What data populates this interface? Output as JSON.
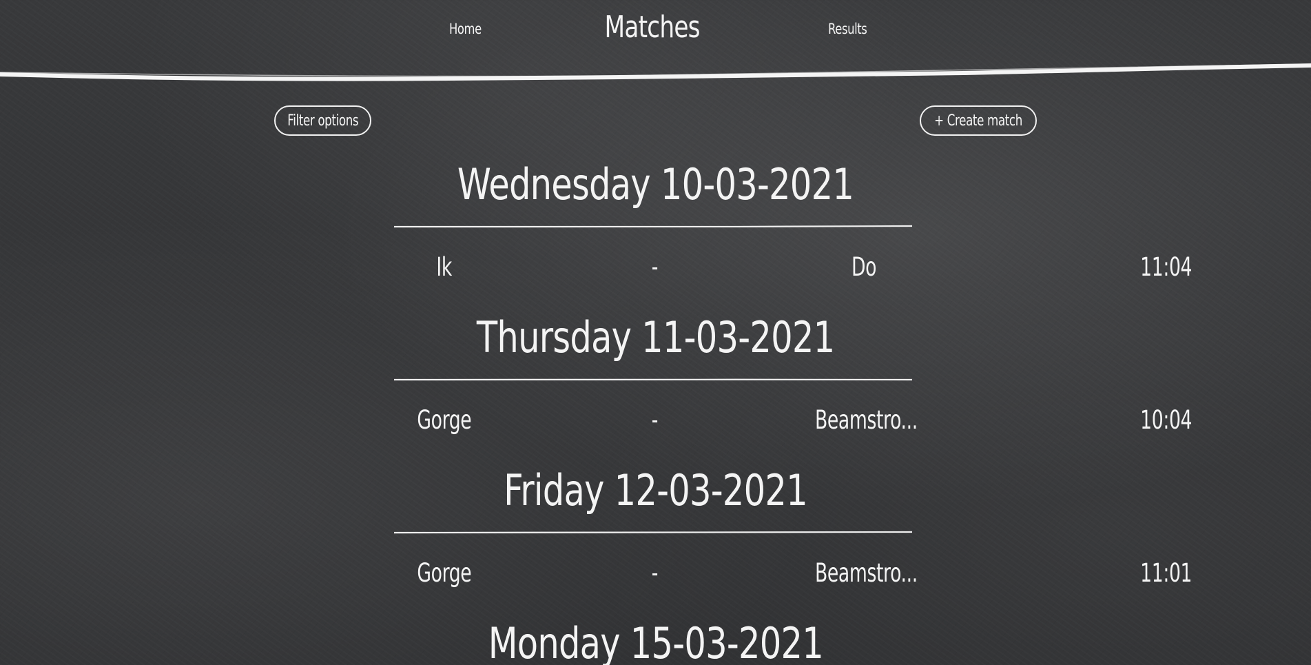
{
  "header": {
    "home_label": "Home",
    "title": "Matches",
    "results_label": "Results"
  },
  "toolbar": {
    "filter_label": "Filter options",
    "create_label": "+ Create match"
  },
  "days": [
    {
      "heading": "Wednesday 10-03-2021",
      "matches": [
        {
          "home": "Ik",
          "separator": "-",
          "away": "Do",
          "time": "11:04"
        }
      ]
    },
    {
      "heading": "Thursday 11-03-2021",
      "matches": [
        {
          "home": "Gorge",
          "separator": "-",
          "away": "Beamstro...",
          "time": "10:04"
        }
      ]
    },
    {
      "heading": "Friday 12-03-2021",
      "matches": [
        {
          "home": "Gorge",
          "separator": "-",
          "away": "Beamstro...",
          "time": "11:01"
        }
      ]
    },
    {
      "heading": "Monday 15-03-2021",
      "matches": []
    }
  ],
  "colors": {
    "background": "#353638",
    "chalk": "#f4f4f4"
  }
}
